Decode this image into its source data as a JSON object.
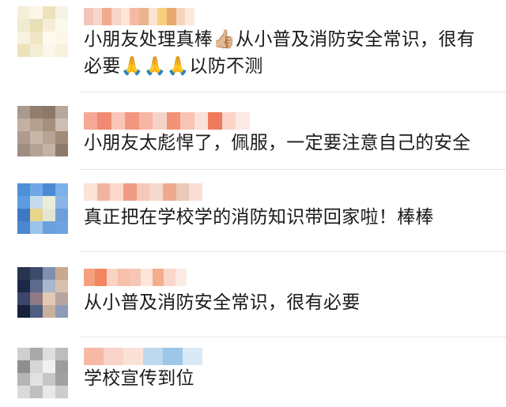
{
  "comments": [
    {
      "line1": "小朋友处理真棒👍🏼从小普及消防安全常识，很有",
      "line2": "必要🙏🙏🙏以防不测",
      "avatar_colors": [
        "#f5efd8",
        "#fbf6e6",
        "#ece3bd",
        "#f7f3e4",
        "#f0ead0",
        "#e8dfb7",
        "#f5eed7",
        "#fbf8ec",
        "#f7f2df",
        "#efe6c5",
        "#fffaf0",
        "#fcf7e9",
        "#ece2b9",
        "#f3edd3",
        "#faf6ea",
        "#f6f0dc"
      ],
      "name_colors": [
        "#f3c6b8",
        "#f7d7cd",
        "#f1a98f",
        "#f7d4c8",
        "#fde3d8",
        "#f5b9a6",
        "#e9b58a",
        "#fbe2d2",
        "#f7d07b",
        "#e7a86c",
        "#f6d6bb",
        "#fce9de"
      ]
    },
    {
      "line1": "小朋友太彪悍了，佩服，一定要注意自己的安全",
      "avatar_colors": [
        "#a89a8c",
        "#927d6e",
        "#8c7869",
        "#b7a89b",
        "#c2b0a2",
        "#b59f8f",
        "#a68f7d",
        "#cdbfb3",
        "#af9c8e",
        "#c8b7a8",
        "#b7a495",
        "#a18b79",
        "#9f8d80",
        "#b4a292",
        "#c2b3a5",
        "#8e7a6b"
      ],
      "name_colors": [
        "#f6a895",
        "#f08a73",
        "#fac6b8",
        "#f3967f",
        "#f7b6a3",
        "#f5d3c9",
        "#f39376",
        "#f9c4b5",
        "#fbe1d9",
        "#f07a5c",
        "#fbd4c8",
        "#fbe9e3"
      ]
    },
    {
      "line1": "真正把在学校学的消防知识带回家啦！棒棒",
      "avatar_colors": [
        "#4f8fd6",
        "#6fa6e6",
        "#4b8ad2",
        "#7bb0e8",
        "#5d9ce1",
        "#c7dbef",
        "#e9eed9",
        "#8ab5e6",
        "#3f79c4",
        "#e9d58a",
        "#e4e6d4",
        "#6d9fd8",
        "#4d87ce",
        "#9cc3eb",
        "#6aa0dc",
        "#6fa3e1"
      ],
      "name_colors": [
        "#fbe3d8",
        "#f1b4a0",
        "#fbd7cc",
        "#f09b82",
        "#f6c8b9",
        "#f6d9cd",
        "#f0a98f",
        "#e9c9b9",
        "#fadfd4"
      ]
    },
    {
      "line1": "从小普及消防安全常识，很有必要",
      "avatar_colors": [
        "#26344f",
        "#3d4b6b",
        "#7f8fb0",
        "#c8a88e",
        "#1c2946",
        "#5d6c8d",
        "#a9b6d0",
        "#d7c0ad",
        "#3b466a",
        "#8f7a84",
        "#e2c9b3",
        "#b9a4a0",
        "#16213b",
        "#4f5e80",
        "#c9b09d",
        "#8e9bb6"
      ],
      "name_colors": [
        "#f6a07f",
        "#f1855f",
        "#fbd3c2",
        "#f7c0a9",
        "#f6c7b3",
        "#fce5db",
        "#f3ad8d",
        "#f9d8c9",
        "#fcebe3"
      ]
    },
    {
      "line1": "学校宣传到位",
      "avatar_colors": [
        "#cfcfcf",
        "#a9a9a9",
        "#dedede",
        "#bdbdbd",
        "#8e8e8e",
        "#d6d6d6",
        "#f0f0f0",
        "#9d9d9d",
        "#b6b6b6",
        "#e2e2e2",
        "#c6c6c6",
        "#a1a1a1",
        "#dadada",
        "#bfbfbf",
        "#e8e8e8",
        "#cdcdcd"
      ],
      "name_colors": [
        "#f6b9a6",
        "#f9d4c8",
        "#fbe2d9",
        "#bcd9ef",
        "#9cc7ea",
        "#d9e9f6"
      ]
    }
  ]
}
